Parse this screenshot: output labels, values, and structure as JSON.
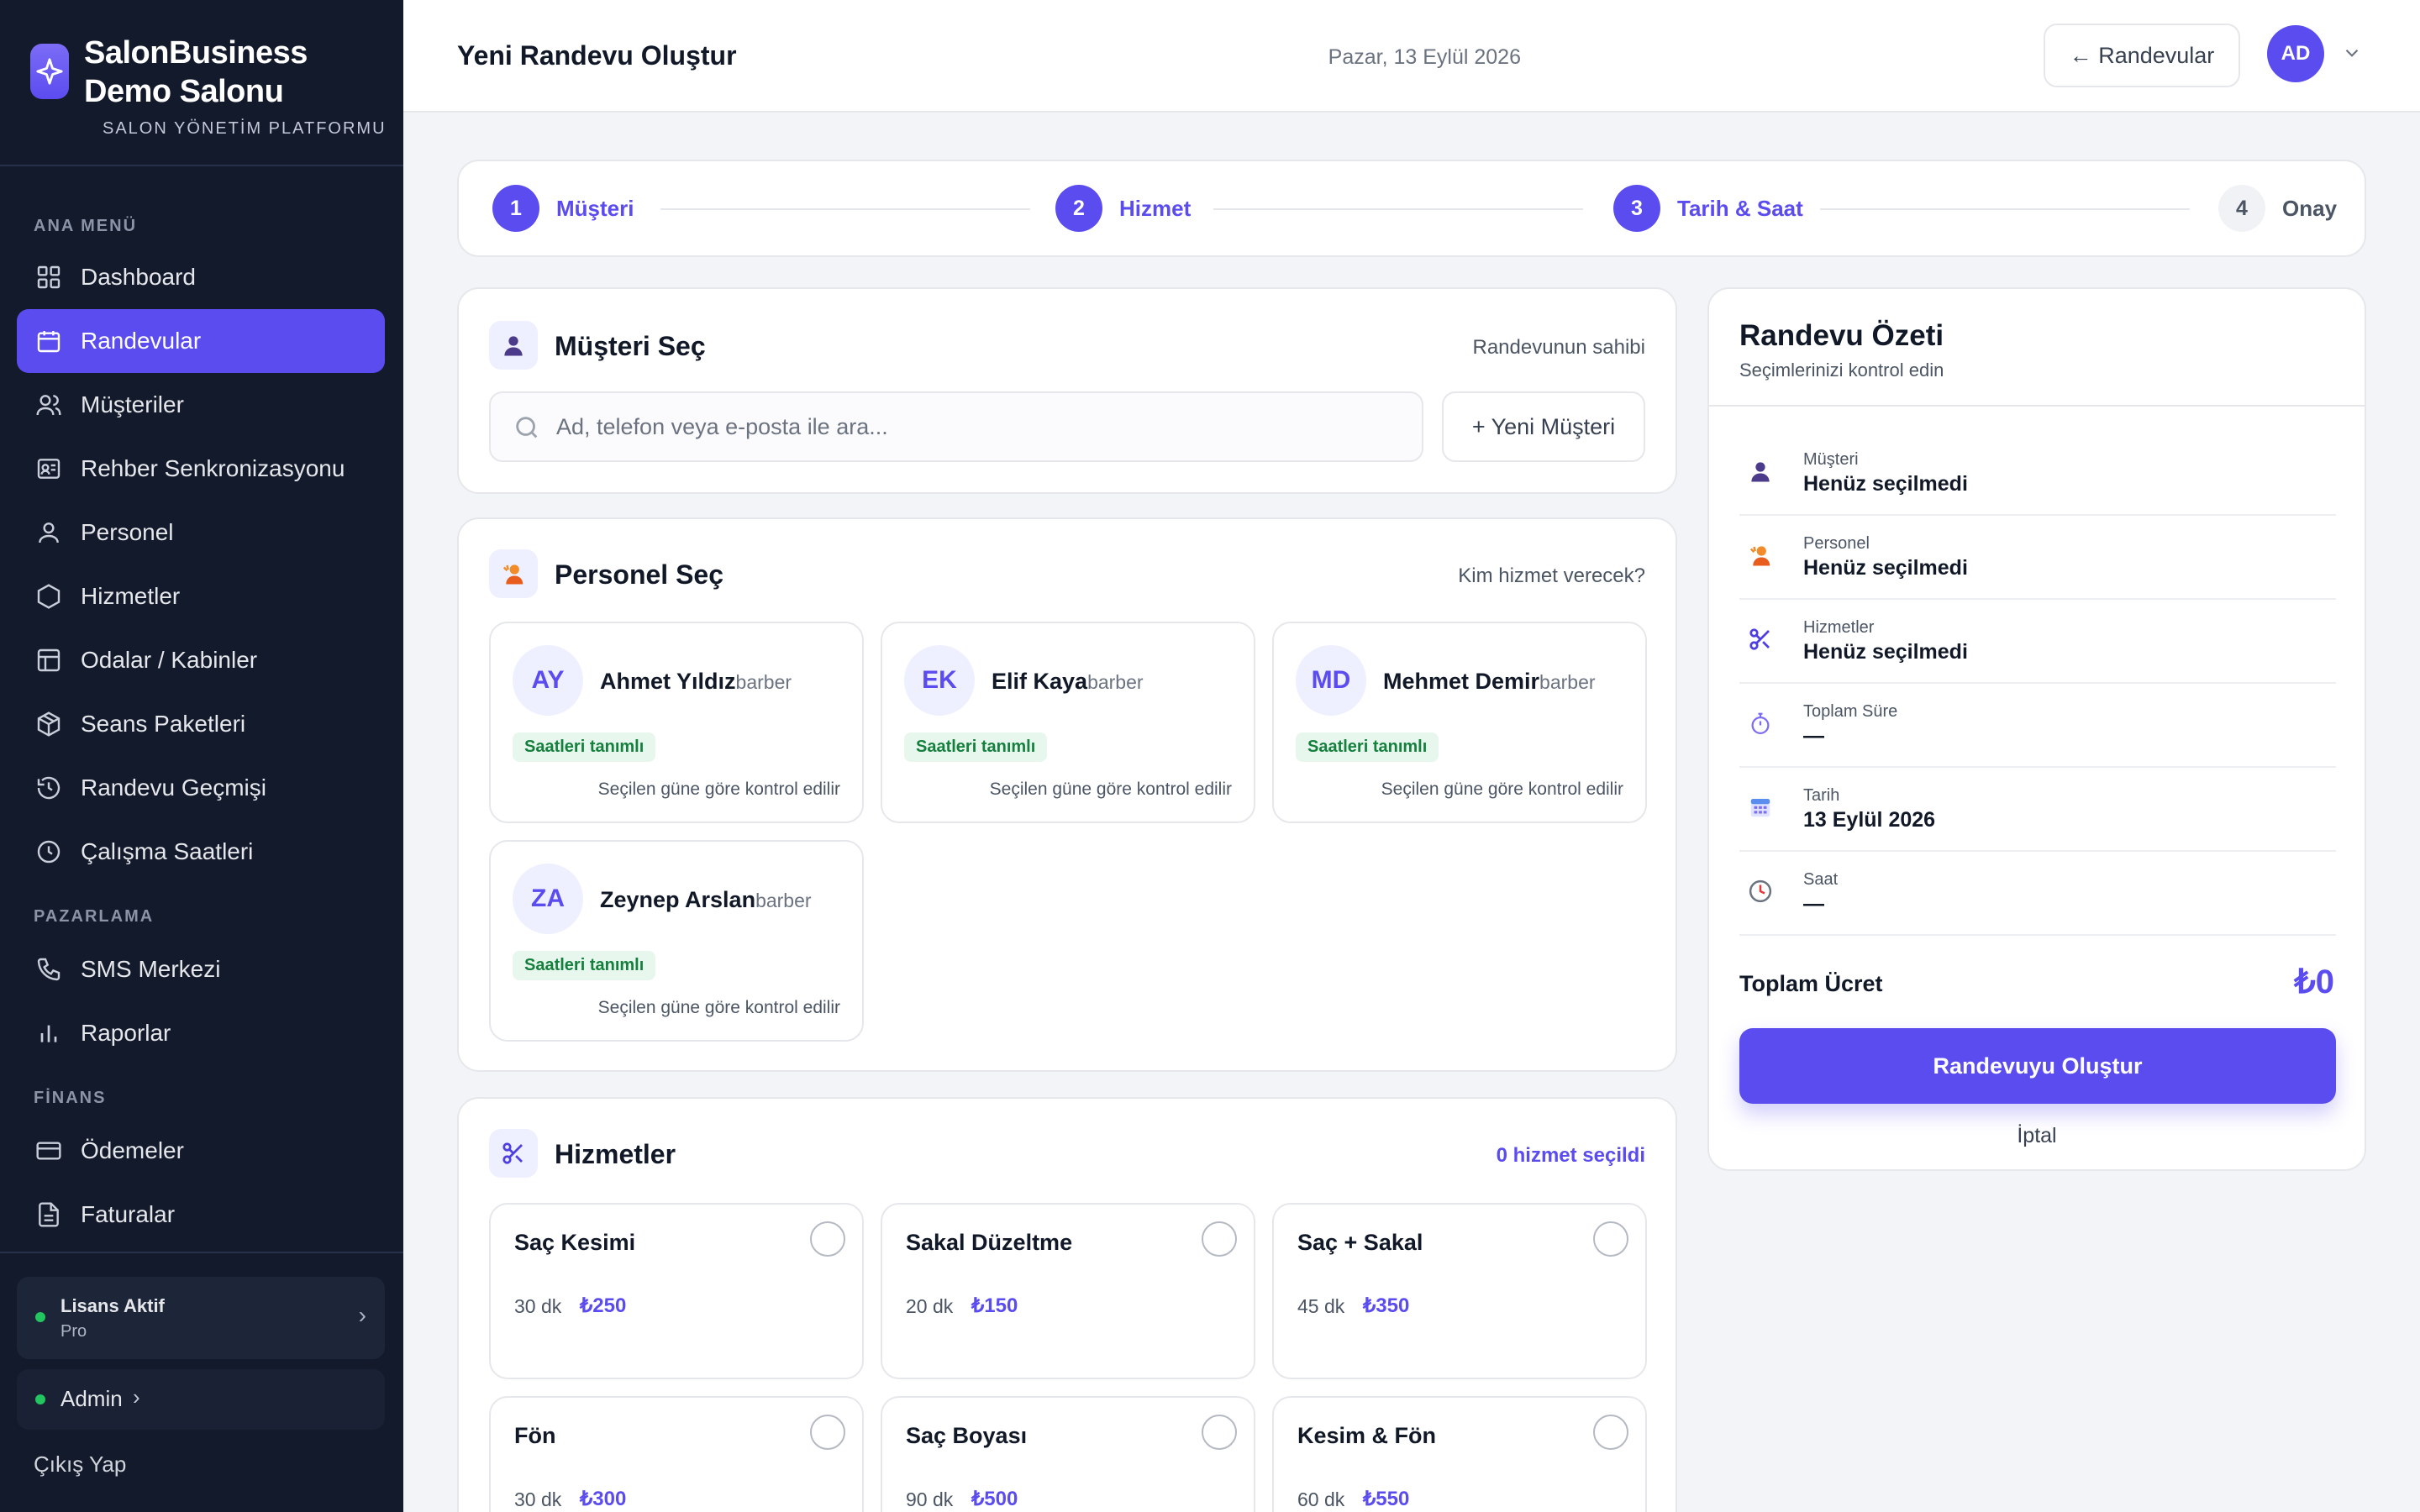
{
  "brand": {
    "name": "SalonBusiness Demo Salonu",
    "subtitle": "SALON YÖNETİM PLATFORMU"
  },
  "sidebar": {
    "sections": [
      "ANA MENÜ",
      "PAZARLAMA",
      "FİNANS"
    ],
    "items": [
      {
        "label": "Dashboard",
        "icon": "grid-icon"
      },
      {
        "label": "Randevular",
        "icon": "calendar-icon",
        "active": true
      },
      {
        "label": "Müşteriler",
        "icon": "users-icon"
      },
      {
        "label": "Rehber Senkronizasyonu",
        "icon": "contact-card-icon"
      },
      {
        "label": "Personel",
        "icon": "user-icon"
      },
      {
        "label": "Hizmetler",
        "icon": "hexagon-icon"
      },
      {
        "label": "Odalar / Kabinler",
        "icon": "layout-icon"
      },
      {
        "label": "Seans Paketleri",
        "icon": "package-icon"
      },
      {
        "label": "Randevu Geçmişi",
        "icon": "history-icon"
      },
      {
        "label": "Çalışma Saatleri",
        "icon": "clock-icon"
      },
      {
        "label": "SMS Merkezi",
        "icon": "phone-icon"
      },
      {
        "label": "Raporlar",
        "icon": "bar-chart-icon"
      },
      {
        "label": "Ödemeler",
        "icon": "credit-card-icon"
      },
      {
        "label": "Faturalar",
        "icon": "file-text-icon"
      }
    ],
    "license": {
      "title": "Lisans Aktif",
      "plan": "Pro",
      "chevron": "›"
    },
    "admin": {
      "label": "Admin",
      "chevron": "›"
    },
    "logout": "Çıkış Yap"
  },
  "topbar": {
    "title": "Yeni Randevu Oluştur",
    "date": "Pazar, 13 Eylül 2026",
    "back_label": "← Randevular",
    "avatar_initials": "AD"
  },
  "stepper": {
    "steps": [
      {
        "num": "1",
        "label": "Müşteri",
        "active": true
      },
      {
        "num": "2",
        "label": "Hizmet",
        "active": true
      },
      {
        "num": "3",
        "label": "Tarih & Saat",
        "active": true
      },
      {
        "num": "4",
        "label": "Onay",
        "active": false
      }
    ]
  },
  "customer": {
    "title": "Müşteri Seç",
    "hint": "Randevunun sahibi",
    "search_placeholder": "Ad, telefon veya e-posta ile ara...",
    "new_label": "+ Yeni Müşteri"
  },
  "staff": {
    "title": "Personel Seç",
    "hint": "Kim hizmet verecek?",
    "members": [
      {
        "initials": "AY",
        "name": "Ahmet Yıldız",
        "role": "barber",
        "badge": "Saatleri tanımlı",
        "note": "Seçilen güne göre kontrol edilir"
      },
      {
        "initials": "EK",
        "name": "Elif Kaya",
        "role": "barber",
        "badge": "Saatleri tanımlı",
        "note": "Seçilen güne göre kontrol edilir"
      },
      {
        "initials": "MD",
        "name": "Mehmet Demir",
        "role": "barber",
        "badge": "Saatleri tanımlı",
        "note": "Seçilen güne göre kontrol edilir"
      },
      {
        "initials": "ZA",
        "name": "Zeynep Arslan",
        "role": "barber",
        "badge": "Saatleri tanımlı",
        "note": "Seçilen güne göre kontrol edilir"
      }
    ]
  },
  "services": {
    "title": "Hizmetler",
    "hint": "0 hizmet seçildi",
    "items": [
      {
        "name": "Saç Kesimi",
        "duration": "30 dk",
        "price": "₺250"
      },
      {
        "name": "Sakal Düzeltme",
        "duration": "20 dk",
        "price": "₺150"
      },
      {
        "name": "Saç + Sakal",
        "duration": "45 dk",
        "price": "₺350"
      },
      {
        "name": "Fön",
        "duration": "30 dk",
        "price": "₺300"
      },
      {
        "name": "Saç Boyası",
        "duration": "90 dk",
        "price": "₺500"
      },
      {
        "name": "Kesim & Fön",
        "duration": "60 dk",
        "price": "₺550"
      }
    ]
  },
  "summary": {
    "title": "Randevu Özeti",
    "subtitle": "Seçimlerinizi kontrol edin",
    "rows": [
      {
        "label": "Müşteri",
        "value": "Henüz seçilmedi",
        "icon": "person-icon"
      },
      {
        "label": "Personel",
        "value": "Henüz seçilmedi",
        "icon": "staff-icon"
      },
      {
        "label": "Hizmetler",
        "value": "Henüz seçilmedi",
        "icon": "scissors-icon"
      },
      {
        "label": "Toplam Süre",
        "value": "—",
        "icon": "stopwatch-icon"
      },
      {
        "label": "Tarih",
        "value": "13 Eylül 2026",
        "icon": "calendar-icon"
      },
      {
        "label": "Saat",
        "value": "—",
        "icon": "clock-icon"
      }
    ],
    "total_label": "Toplam Ücret",
    "total_value": "₺0",
    "create_label": "Randevuyu Oluştur",
    "cancel_label": "İptal"
  },
  "colors": {
    "accent": "#5b4cf0",
    "sidebar": "#131a2c",
    "success": "#22c55e"
  }
}
